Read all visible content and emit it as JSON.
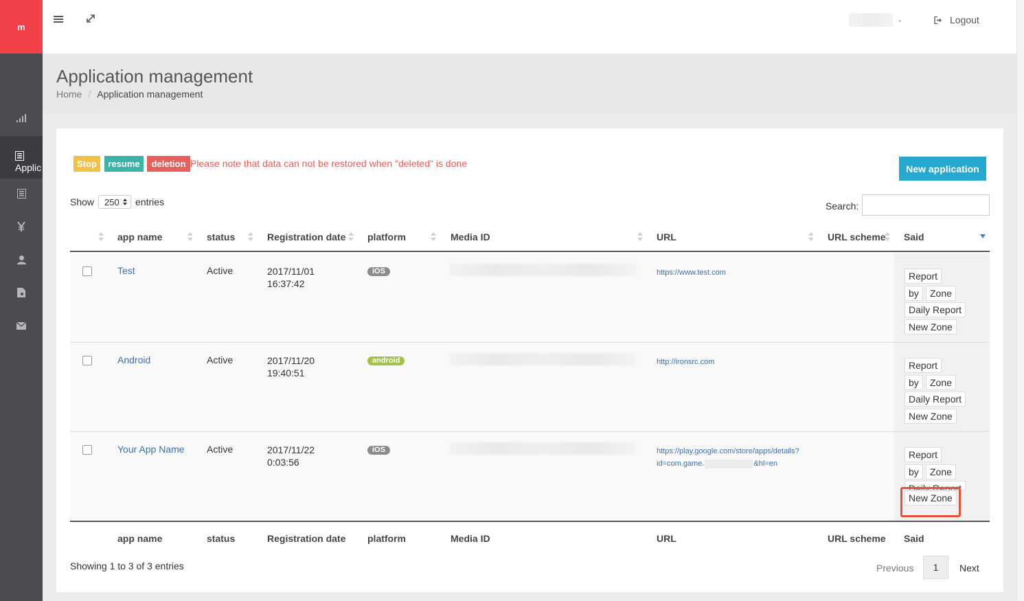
{
  "brand": {
    "logo": "m",
    "color": "#f3414a"
  },
  "sidebar": {
    "active_label": "Applic"
  },
  "topbar": {
    "logout": "Logout"
  },
  "page": {
    "title": "Application management",
    "breadcrumb_home": "Home",
    "breadcrumb_current": "Application management"
  },
  "actions": {
    "stop": "Stop",
    "resume": "resume",
    "deletion": "deletion",
    "note": "Please note that data can not be restored when \"deleted\" is done",
    "new_application": "New application"
  },
  "colors": {
    "stop": "#f0c142",
    "resume": "#3bb3a6",
    "deletion": "#e8605c",
    "primary": "#25a9d1",
    "link": "#3c6fb0"
  },
  "table": {
    "show_label": "Show",
    "entries_value": "250",
    "entries_label": "entries",
    "search_label": "Search:",
    "search_value": "",
    "headers": [
      "app name",
      "status",
      "Registration date",
      "platform",
      "Media ID",
      "URL",
      "URL scheme",
      "Said"
    ],
    "rows": [
      {
        "app_name": "Test",
        "status": "Active",
        "date1": "2017/11/01",
        "date2": "16:37:42",
        "platform": "iOS",
        "url1": "https://www.test.com",
        "url2_pre": "",
        "url2_post": ""
      },
      {
        "app_name": "Android",
        "status": "Active",
        "date1": "2017/11/20",
        "date2": "19:40:51",
        "platform": "android",
        "url1": "http://ironsrc.com",
        "url2_pre": "",
        "url2_post": ""
      },
      {
        "app_name": "Your App Name",
        "status": "Active",
        "date1": "2017/11/22",
        "date2": "0:03:56",
        "platform": "iOS",
        "url1": "https://play.google.com/store/apps/details?",
        "url2_pre": "id=com.game.",
        "url2_post": "&hl=en"
      }
    ],
    "said_buttons": {
      "report": "Report",
      "by": "by",
      "zone": "Zone",
      "daily_report": "Daily Report",
      "new_zone": "New Zone"
    },
    "info": "Showing 1 to 3 of 3 entries",
    "pagination": {
      "previous": "Previous",
      "page": "1",
      "next": "Next"
    }
  }
}
